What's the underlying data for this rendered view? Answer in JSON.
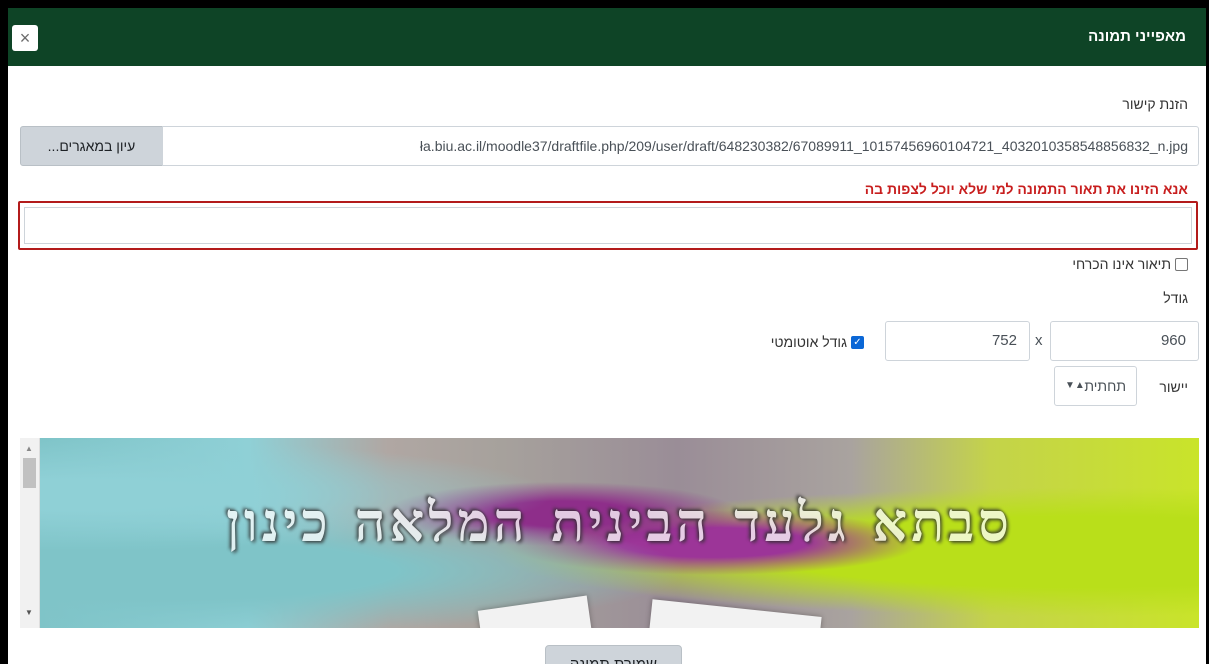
{
  "dialog": {
    "title": "מאפייני תמונה",
    "close_glyph": "×"
  },
  "url": {
    "label": "הזנת קישור",
    "value": "ła.biu.ac.il/moodle37/draftfile.php/209/user/draft/648230382/67089911_10157456960104721_4032010358548856832_n.jpg",
    "browse_label": "עיון במאגרים..."
  },
  "description": {
    "error": "אנא הזינו את תאור התמונה למי שלא יוכל לצפות בה",
    "value": "",
    "not_required_label": "תיאור אינו הכרחי",
    "not_required_checked": false
  },
  "size": {
    "label": "גודל",
    "width": "960",
    "separator": "x",
    "height": "752",
    "auto_label": "גודל אוטומטי",
    "auto_checked": true
  },
  "alignment": {
    "label": "יישור",
    "selected": "תחתית"
  },
  "preview": {
    "image_text": "סבתא גלעד הבינית המלאה כינון"
  },
  "footer": {
    "save_label": "שמירת תמונה"
  },
  "icons": {
    "close": "close-icon",
    "checkbox": "checkbox-icon",
    "select_arrows": "select-arrows-icon",
    "scroll_up": "scroll-up-icon",
    "scroll_down": "scroll-down-icon"
  }
}
